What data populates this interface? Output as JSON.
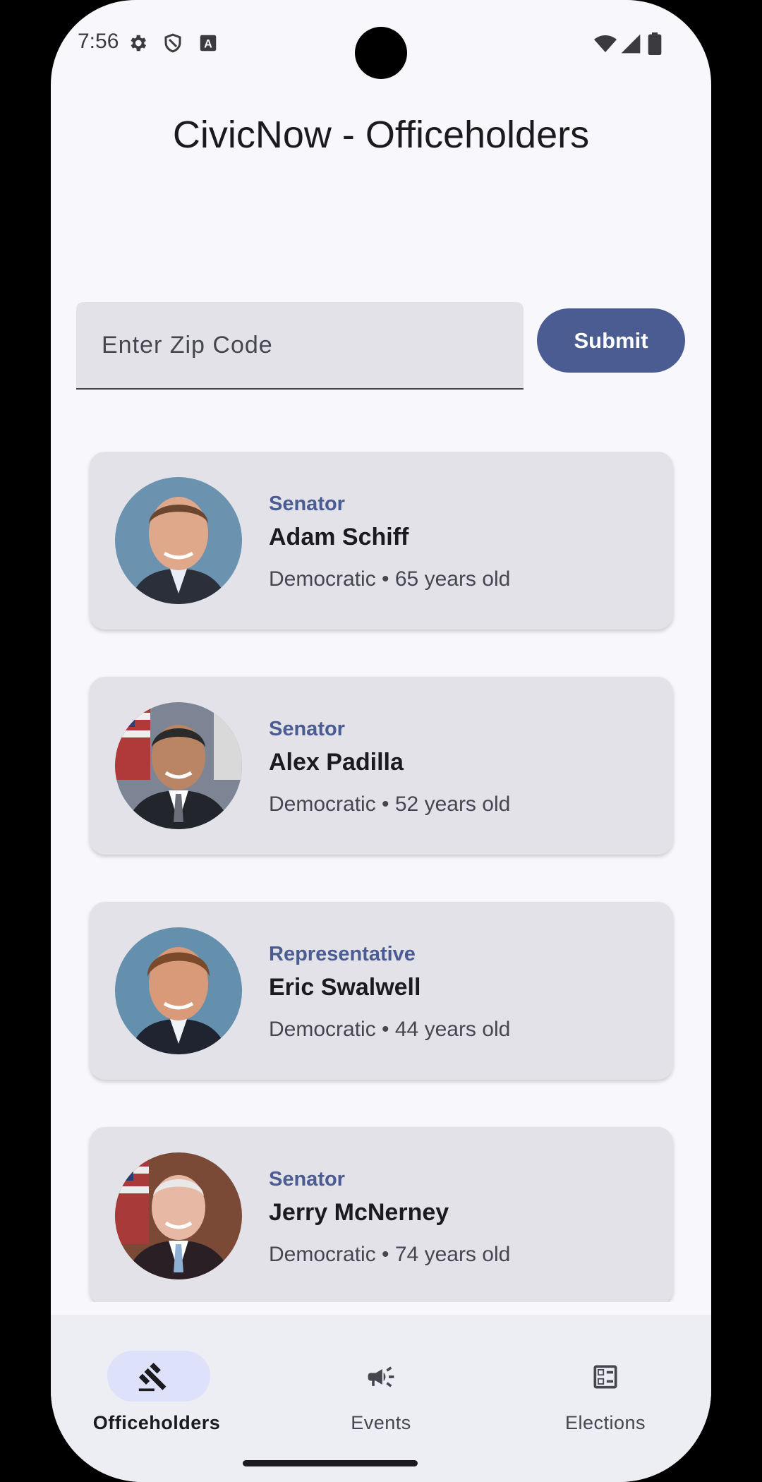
{
  "status_bar": {
    "time": "7:56",
    "left_icons": [
      "settings-icon",
      "shield-icon",
      "keyboard-a-icon"
    ],
    "right_icons": [
      "wifi-icon",
      "signal-icon",
      "battery-icon"
    ]
  },
  "header": {
    "title": "CivicNow - Officeholders"
  },
  "search": {
    "placeholder": "Enter Zip Code",
    "value": "",
    "submit_label": "Submit"
  },
  "officeholders": [
    {
      "role": "Senator",
      "name": "Adam Schiff",
      "details": "Democratic • 65 years old"
    },
    {
      "role": "Senator",
      "name": "Alex Padilla",
      "details": "Democratic • 52 years old"
    },
    {
      "role": "Representative",
      "name": "Eric Swalwell",
      "details": "Democratic • 44 years old"
    },
    {
      "role": "Senator",
      "name": "Jerry McNerney",
      "details": "Democratic • 74 years old"
    }
  ],
  "bottom_nav": {
    "items": [
      {
        "label": "Officeholders",
        "icon": "gavel-icon",
        "active": true
      },
      {
        "label": "Events",
        "icon": "megaphone-icon",
        "active": false
      },
      {
        "label": "Elections",
        "icon": "ballot-icon",
        "active": false
      }
    ]
  },
  "colors": {
    "accent": "#4a5c92",
    "card_bg": "#e2e2e8",
    "page_bg": "#f8f8fc",
    "nav_indicator": "#dde1f9"
  }
}
